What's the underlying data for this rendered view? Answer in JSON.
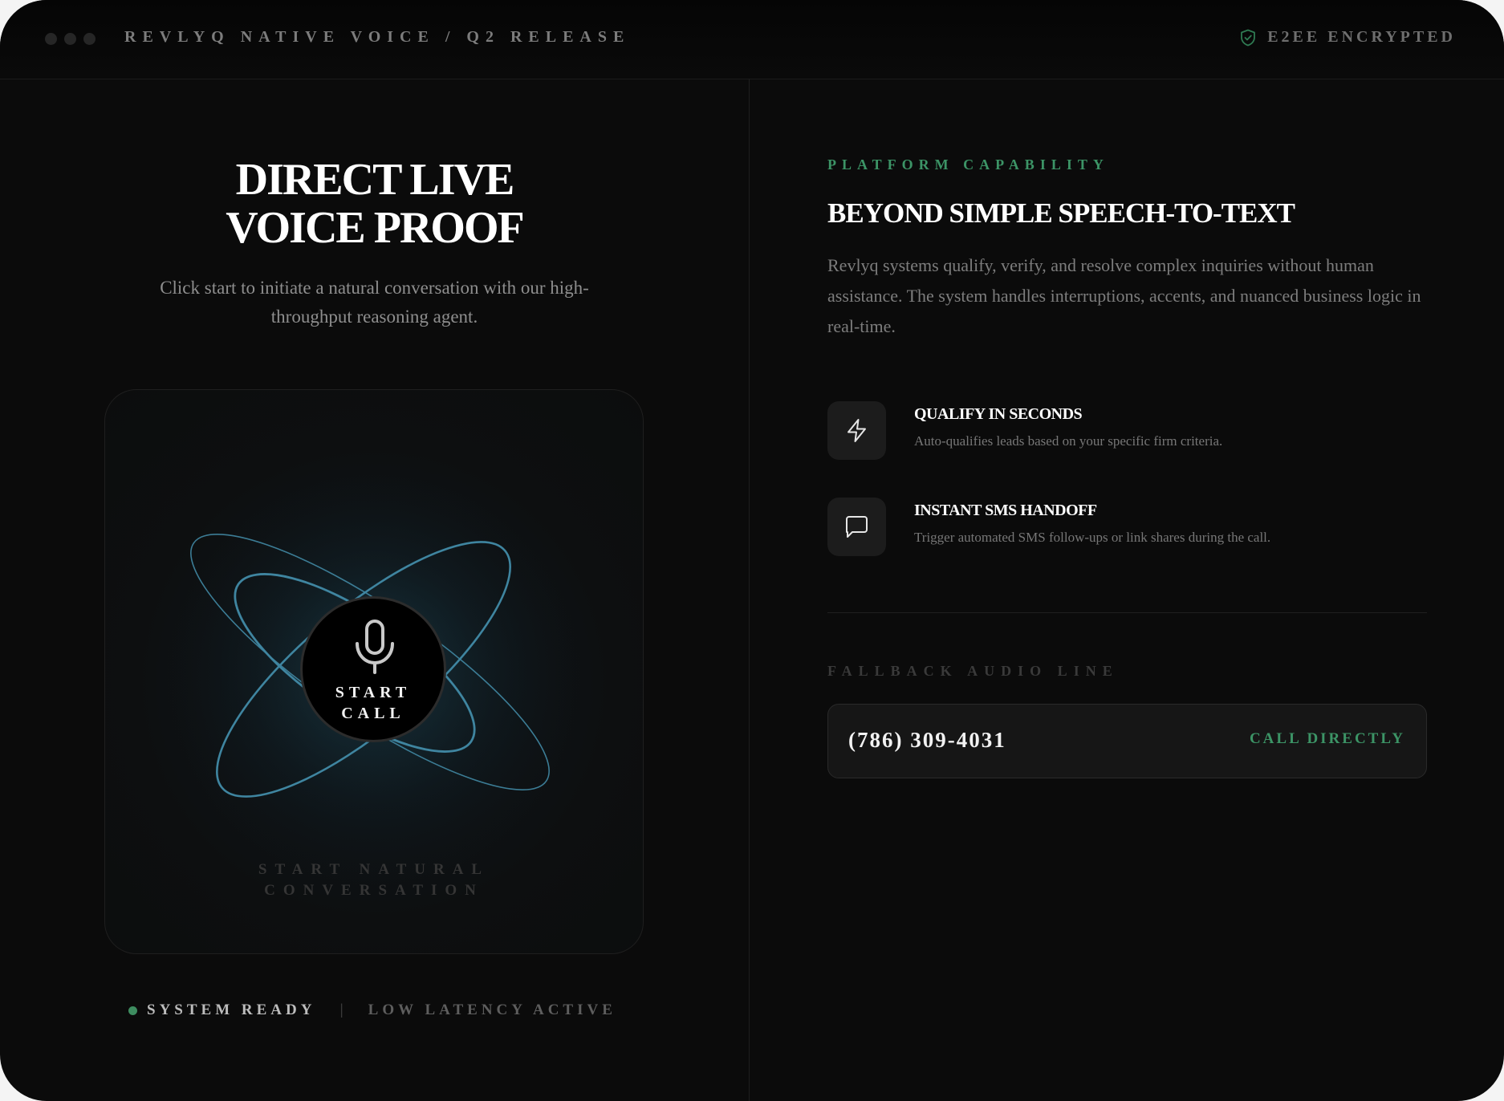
{
  "window": {
    "title": "REVLYQ NATIVE VOICE / Q2 RELEASE",
    "encryption_label": "E2EE ENCRYPTED",
    "encryption_icon": "shield-check-icon"
  },
  "hero": {
    "title_line1": "DIRECT LIVE",
    "title_line2": "VOICE PROOF",
    "subtitle": "Click start to initiate a natural conversation with our high-throughput reasoning agent."
  },
  "call_card": {
    "mic_icon": "microphone-icon",
    "button_line1": "START",
    "button_line2": "CALL",
    "caption_line1": "START NATURAL",
    "caption_line2": "CONVERSATION"
  },
  "status": {
    "ready": "SYSTEM READY",
    "separator": "|",
    "latency": "LOW LATENCY ACTIVE"
  },
  "capability": {
    "eyebrow": "PLATFORM CAPABILITY",
    "title": "BEYOND SIMPLE SPEECH-TO-TEXT",
    "body": "Revlyq systems qualify, verify, and resolve complex inquiries without human assistance. The system handles interruptions, accents, and nuanced business logic in real-time.",
    "features": [
      {
        "icon": "lightning-icon",
        "title": "QUALIFY IN SECONDS",
        "desc": "Auto-qualifies leads based on your specific firm criteria."
      },
      {
        "icon": "chat-bubble-icon",
        "title": "INSTANT SMS HANDOFF",
        "desc": "Trigger automated SMS follow-ups or link shares during the call."
      }
    ]
  },
  "fallback": {
    "label": "FALLBACK AUDIO LINE",
    "phone": "(786) 309-4031",
    "call_label": "CALL DIRECTLY"
  },
  "colors": {
    "accent_green": "#3c9466",
    "orbit_blue": "#3f7f99",
    "background": "#0b0b0b"
  }
}
